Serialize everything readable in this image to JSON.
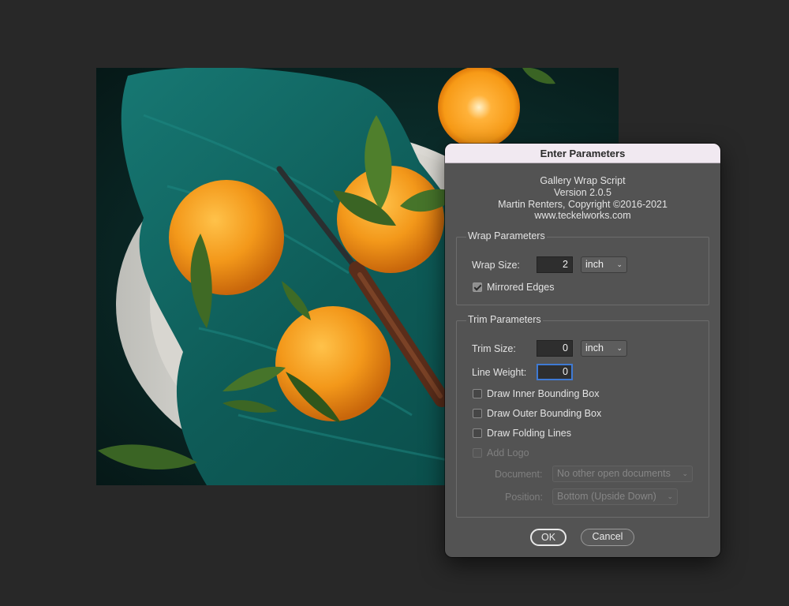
{
  "dialog": {
    "title": "Enter Parameters",
    "credits": {
      "line1": "Gallery Wrap Script",
      "line2": "Version 2.0.5",
      "line3": "Martin Renters, Copyright ©2016-2021",
      "line4": "www.teckelworks.com"
    },
    "wrap": {
      "title": "Wrap Parameters",
      "size_label": "Wrap Size:",
      "size_value": "2",
      "size_unit": "inch",
      "mirrored_label": "Mirrored Edges",
      "mirrored_checked": true
    },
    "trim": {
      "title": "Trim Parameters",
      "size_label": "Trim Size:",
      "size_value": "0",
      "size_unit": "inch",
      "weight_label": "Line Weight:",
      "weight_value": "0",
      "inner_box_label": "Draw Inner Bounding Box",
      "outer_box_label": "Draw Outer Bounding Box",
      "folding_label": "Draw Folding Lines",
      "logo_label": "Add Logo",
      "document_label": "Document:",
      "document_value": "No other open documents",
      "position_label": "Position:",
      "position_value": "Bottom (Upside Down)"
    },
    "ok_label": "OK",
    "cancel_label": "Cancel"
  },
  "colors": {
    "app_background": "#282828",
    "dialog_background": "#535353",
    "titlebar": "#f1e9f1",
    "focus_ring": "#3f7ad4",
    "orange": "#f39a1c",
    "towel": "#0f5a55"
  },
  "icons": {
    "checkbox": "checkbox-icon",
    "dropdown": "chevron-down-icon"
  }
}
